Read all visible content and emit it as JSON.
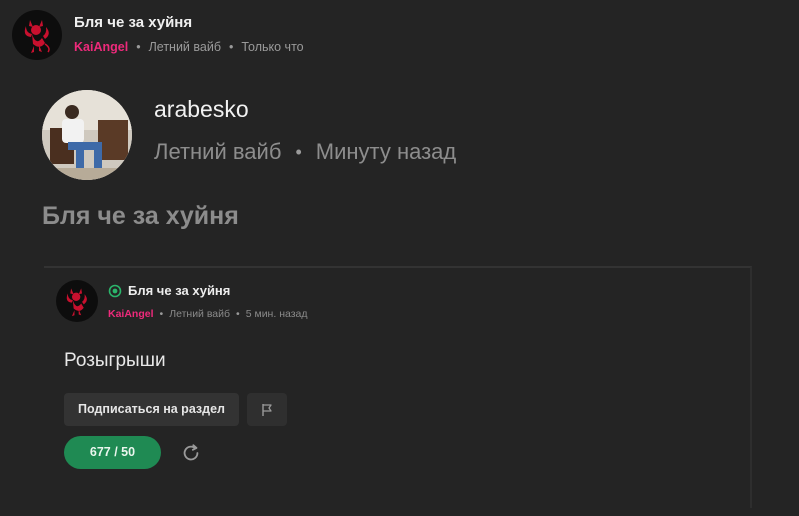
{
  "post": {
    "title": "Бля че за хуйня",
    "author": "KaiAngel",
    "category": "Летний вайб",
    "time": "Только что",
    "separator": "•"
  },
  "quote": {
    "username": "arabesko",
    "category": "Летний вайб",
    "time": "Минуту назад",
    "separator": "•",
    "text": "Бля че за хуйня"
  },
  "embed": {
    "title": "Бля че за хуйня",
    "author": "KaiAngel",
    "category": "Летний вайб",
    "time": "5 мин. назад",
    "separator": "•",
    "section_title": "Розыгрыши",
    "subscribe_label": "Подписаться на раздел",
    "counter": "677 / 50"
  },
  "icons": {
    "avatar": "devil-avatar",
    "online": "online-status-icon",
    "flag": "flag-icon",
    "refresh": "refresh-icon"
  },
  "colors": {
    "background": "#242424",
    "author": "#ee2a7b",
    "counter_bg": "#1f8a53",
    "online": "#2bb56b"
  }
}
